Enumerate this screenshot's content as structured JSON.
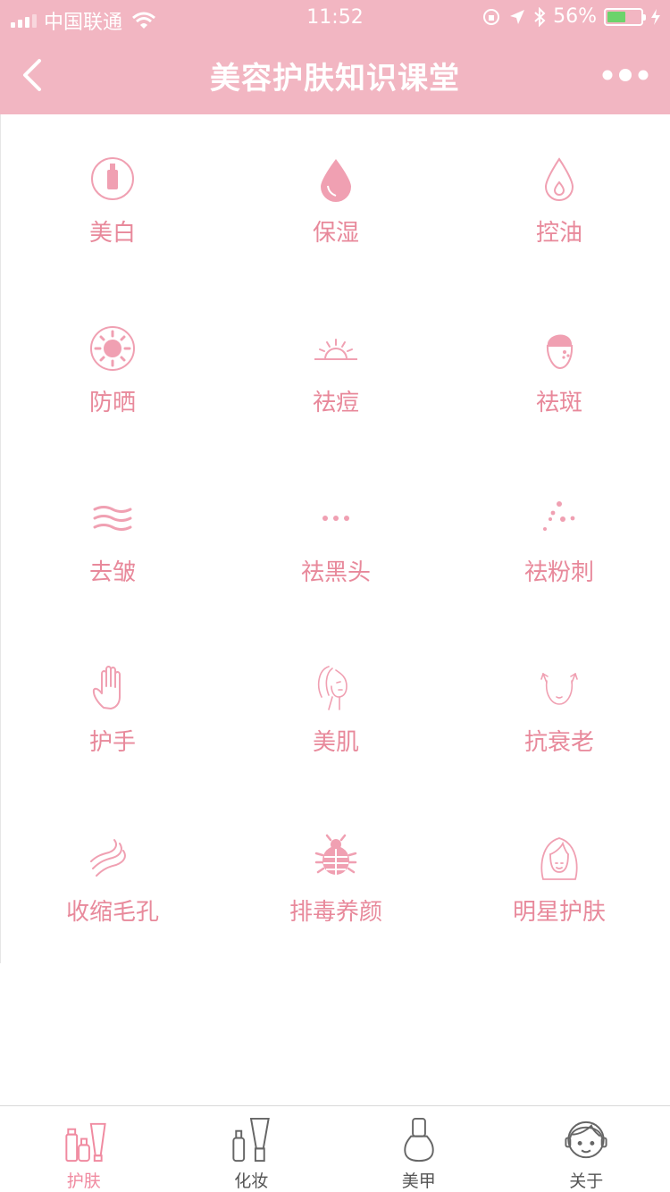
{
  "status_bar": {
    "carrier": "中国联通",
    "time": "11:52",
    "battery": "56%",
    "battery_level": 0.56
  },
  "nav": {
    "title": "美容护肤知识课堂"
  },
  "categories": [
    {
      "label": "美白",
      "icon": "whitening-bottle-icon"
    },
    {
      "label": "保湿",
      "icon": "water-drop-icon"
    },
    {
      "label": "控油",
      "icon": "oil-drop-icon"
    },
    {
      "label": "防晒",
      "icon": "sun-icon"
    },
    {
      "label": "祛痘",
      "icon": "sunrise-icon"
    },
    {
      "label": "祛斑",
      "icon": "face-spots-icon"
    },
    {
      "label": "去皱",
      "icon": "waves-icon"
    },
    {
      "label": "祛黑头",
      "icon": "dots-icon"
    },
    {
      "label": "祛粉刺",
      "icon": "scattered-dots-icon"
    },
    {
      "label": "护手",
      "icon": "hand-icon"
    },
    {
      "label": "美肌",
      "icon": "woman-face-icon"
    },
    {
      "label": "抗衰老",
      "icon": "face-lift-icon"
    },
    {
      "label": "收缩毛孔",
      "icon": "pores-icon"
    },
    {
      "label": "排毒养颜",
      "icon": "bug-icon"
    },
    {
      "label": "明星护肤",
      "icon": "woman-portrait-icon"
    }
  ],
  "tabs": [
    {
      "label": "护肤",
      "icon": "skincare-bottles-icon",
      "active": true
    },
    {
      "label": "化妆",
      "icon": "makeup-tube-icon",
      "active": false
    },
    {
      "label": "美甲",
      "icon": "nail-polish-icon",
      "active": false
    },
    {
      "label": "关于",
      "icon": "support-person-icon",
      "active": false
    }
  ],
  "colors": {
    "accent": "#f2b6c2",
    "icon_pink": "#f0a0b2",
    "label_pink": "#e8899b",
    "tab_active": "#f08aa0",
    "tab_inactive": "#555555"
  }
}
